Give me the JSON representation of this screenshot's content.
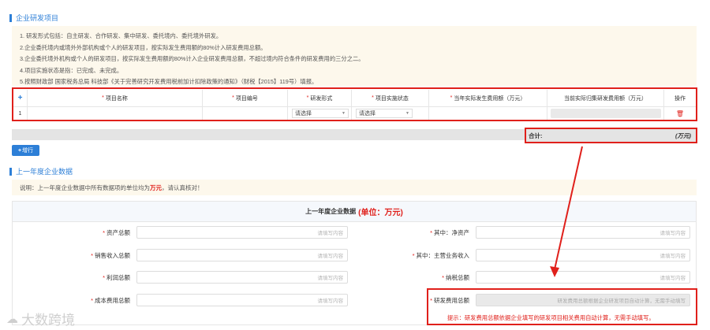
{
  "section1": {
    "title": "企业研发项目"
  },
  "notes": [
    "1. 研发形式包括：自主研发、合作研发、集中研发、委托境内、委托境外研发。",
    "2.企业委托境内或境外外部机构或个人的研发项目，按实际发生费用额的80%计入研发费用总额。",
    "3.企业委托境外机构或个人的研发项目，按实际发生费用额的80%计入企业研发费用总额，不超过境内符合条件的研发费用的三分之二。",
    "4.项目实施状态是指：已完成、未完成。",
    "5.按照财政部 国家税务总局 科技部《关于完善研究开发费用税前加计扣除政策的通知》（财税【2015】119号）填报。"
  ],
  "table": {
    "add_icon": "+",
    "headers": {
      "name": "项目名称",
      "code": "项目编号",
      "form": "研发形式",
      "status": "项目实施状态",
      "year_cost": "当年实际发生费用额（万元）",
      "total_cost": "当前实际归集研发费用额（万元）",
      "action": "操作"
    },
    "rows": [
      {
        "index": "1",
        "form": "请选择",
        "status": "请选择"
      }
    ],
    "total_label": "合计:",
    "total_unit": "(万元)",
    "add_button": "增行"
  },
  "section2": {
    "title": "上一年度企业数据"
  },
  "note2": {
    "prefix": "说明：上一年度企业数据中所有数据项的单位均为",
    "unit": "万元",
    "suffix": "，请认真核对！"
  },
  "data_table": {
    "title": "上一年度企业数据",
    "title_unit": "(单位：万元)",
    "left_fields": [
      "资产总额",
      "销售收入总额",
      "利润总额",
      "成本费用总额"
    ],
    "right_fields": [
      "其中：净资产",
      "其中：主营业务收入",
      "纳税总额",
      "研发费用总额"
    ],
    "placeholder": "请填写内容",
    "rd_placeholder": "研发费用总额根据企业研发项目自动计算，无需手动填写",
    "hint": "提示：研发费用总额依据企业填写的研发项目相关费用自动计算，无需手动填写。"
  },
  "watermark": "大数跨境",
  "colors": {
    "accent": "#2d7fd7",
    "highlight": "#e0201b",
    "note_bg": "#fdf8ec"
  }
}
